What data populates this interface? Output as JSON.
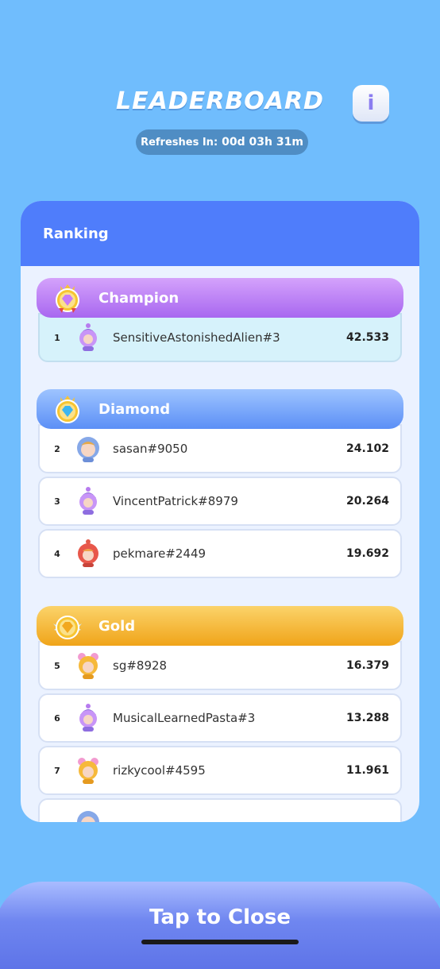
{
  "header": {
    "title": "LEADERBOARD",
    "info_label": "i",
    "refresh_label": "Refreshes In:",
    "refresh_value": "00d 03h 31m"
  },
  "panel": {
    "heading": "Ranking",
    "tiers": [
      {
        "label": "Champion",
        "rows": [
          {
            "rank": "1",
            "name": "SensitiveAstonishedAlien#3",
            "score": "42.533"
          }
        ]
      },
      {
        "label": "Diamond",
        "rows": [
          {
            "rank": "2",
            "name": "sasan#9050",
            "score": "24.102"
          },
          {
            "rank": "3",
            "name": "VincentPatrick#8979",
            "score": "20.264"
          },
          {
            "rank": "4",
            "name": "pekmare#2449",
            "score": "19.692"
          }
        ]
      },
      {
        "label": "Gold",
        "rows": [
          {
            "rank": "5",
            "name": "sg#8928",
            "score": "16.379"
          },
          {
            "rank": "6",
            "name": "MusicalLearnedPasta#3",
            "score": "13.288"
          },
          {
            "rank": "7",
            "name": "rizkycool#4595",
            "score": "11.961"
          }
        ]
      }
    ]
  },
  "footer": {
    "close_label": "Tap to Close"
  },
  "colors": {
    "background": "#70bdfd",
    "panel_header": "#4f7dfb",
    "champion": "#b87df4",
    "diamond": "#6d9cf8",
    "gold": "#f2ae2a"
  }
}
